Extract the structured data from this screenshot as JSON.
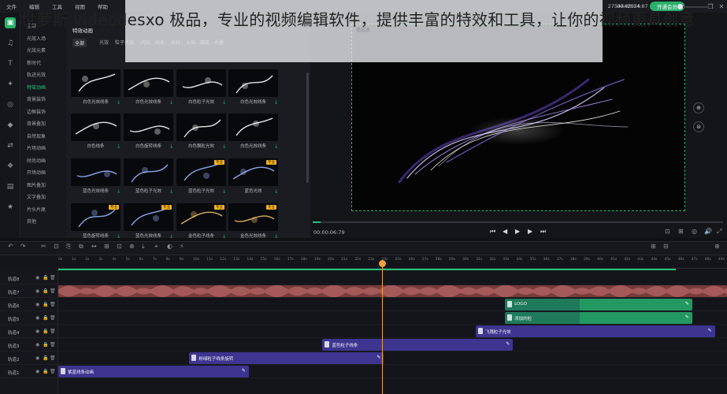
{
  "menu": {
    "items": [
      "文件",
      "编辑",
      "工具",
      "视图",
      "帮助"
    ],
    "user_id": "2754442924",
    "vip_label": "开通会员",
    "window_controls": [
      "—",
      "❐",
      "✕"
    ]
  },
  "rail": {
    "icons": [
      "media-icon",
      "music-icon",
      "text-icon",
      "effects-icon",
      "filter-icon",
      "element-icon",
      "transition-icon",
      "sticker-icon",
      "template-icon",
      "favorite-icon"
    ],
    "glyphs": [
      "▣",
      "♫",
      "T",
      "✦",
      "◎",
      "◆",
      "⇄",
      "❖",
      "▤",
      "★"
    ]
  },
  "categories": [
    "全部",
    "光效入场",
    "光效元素",
    "新时代",
    "轨迹光效",
    "特效动画",
    "背景装饰",
    "边框装饰",
    "背景叠加",
    "自然现象",
    "片场动画",
    "时尚动画",
    "开场动画",
    "图片叠加",
    "文字叠加",
    "片头片尾",
    "其他"
  ],
  "library": {
    "top_label": "特效动画",
    "tabs": [
      "全部",
      "光效",
      "粒子光效",
      "闪光",
      "线条",
      "光线",
      "火焰",
      "烟花",
      "水墨"
    ],
    "thumbs": [
      {
        "label": "白色光效线条",
        "badge": ""
      },
      {
        "label": "白色光效线条",
        "badge": ""
      },
      {
        "label": "白色粒子光效",
        "badge": ""
      },
      {
        "label": "白色光效线条",
        "badge": ""
      },
      {
        "label": "白色线条",
        "badge": ""
      },
      {
        "label": "白色旋转线条",
        "badge": ""
      },
      {
        "label": "白色飘粒光效",
        "badge": ""
      },
      {
        "label": "白色光效线条",
        "badge": ""
      },
      {
        "label": "蓝色光效线条",
        "badge": ""
      },
      {
        "label": "蓝色粒子光效",
        "badge": ""
      },
      {
        "label": "蓝色粒子光效",
        "badge": "专业"
      },
      {
        "label": "蓝色光效",
        "badge": "专业"
      },
      {
        "label": "蓝色旋转线条",
        "badge": "专业"
      },
      {
        "label": "蓝色光效线条",
        "badge": "专业"
      },
      {
        "label": "金色粒子线条",
        "badge": "专业"
      },
      {
        "label": "金色光效线条",
        "badge": "专业"
      }
    ]
  },
  "preview": {
    "tab_label": "播放器",
    "current_time": "00:00:06:79",
    "progress": 0.02,
    "playback_glyphs": [
      "⏮",
      "◀",
      "▶",
      "▶",
      "⏭"
    ],
    "right_glyphs": [
      "⊡",
      "⊞",
      "◎",
      "🔊",
      "⤢"
    ],
    "side_glyphs": [
      "⊕",
      "⊜"
    ]
  },
  "caption": "世萝斯 videodesxo 极品，专业的视频编辑软件，提供丰富的特效和工具，让你的视频更具创意",
  "toolbar": {
    "total_time": "00:00:14:87",
    "glyphs": [
      "↶",
      "↷",
      "✂",
      "⊡",
      "⎘",
      "⧉",
      "↔",
      "⊞",
      "⊡",
      "⊗",
      "⤓",
      "⌖",
      "◐",
      "⚡"
    ],
    "right_glyphs": [
      "⊞",
      "⊟",
      "⊕"
    ]
  },
  "ruler_labels": [
    "0s",
    "1s",
    "2s",
    "3s",
    "4s",
    "5s",
    "6s",
    "7s",
    "8s",
    "9s",
    "10s",
    "11s",
    "12s",
    "13s",
    "14s",
    "15s",
    "16s",
    "17s",
    "18s",
    "19s",
    "20s",
    "21s",
    "22s",
    "23s",
    "24s",
    "25s",
    "26s",
    "27s",
    "28s",
    "29s",
    "30s",
    "31s",
    "32s",
    "33s",
    "34s",
    "35s",
    "36s",
    "37s",
    "38s",
    "39s",
    "40s",
    "41s",
    "42s",
    "43s",
    "44s",
    "45s",
    "46s",
    "47s",
    "48s",
    "49s"
  ],
  "tracks": [
    "轨道8",
    "轨道7",
    "轨道6",
    "轨道5",
    "轨道4",
    "轨道3",
    "轨道2",
    "轨道1"
  ],
  "clips": [
    {
      "track": 1,
      "label": "",
      "type": "audio",
      "start": 0.0,
      "end": 1.0,
      "color": "#7a3b3b"
    },
    {
      "track": 2,
      "label": "LOGO",
      "type": "green",
      "start": 0.668,
      "end": 0.948,
      "color": "#1f7a5c"
    },
    {
      "track": 3,
      "label": "添加的粒",
      "type": "green",
      "start": 0.668,
      "end": 0.948,
      "color": "#1f7a5c"
    },
    {
      "track": 4,
      "label": "飞溅粒子光效",
      "type": "purple",
      "start": 0.624,
      "end": 0.982,
      "color": "#3d3590"
    },
    {
      "track": 5,
      "label": "蓝色粒子线条",
      "type": "purple",
      "start": 0.395,
      "end": 0.68,
      "color": "#3d3590"
    },
    {
      "track": 6,
      "label": "粉绿粒子线条旋转",
      "type": "purple",
      "start": 0.196,
      "end": 0.487,
      "color": "#3d3590"
    },
    {
      "track": 7,
      "label": "紫蓝线条动画",
      "type": "purple",
      "start": 0.0,
      "end": 0.285,
      "color": "#3d3590"
    }
  ]
}
